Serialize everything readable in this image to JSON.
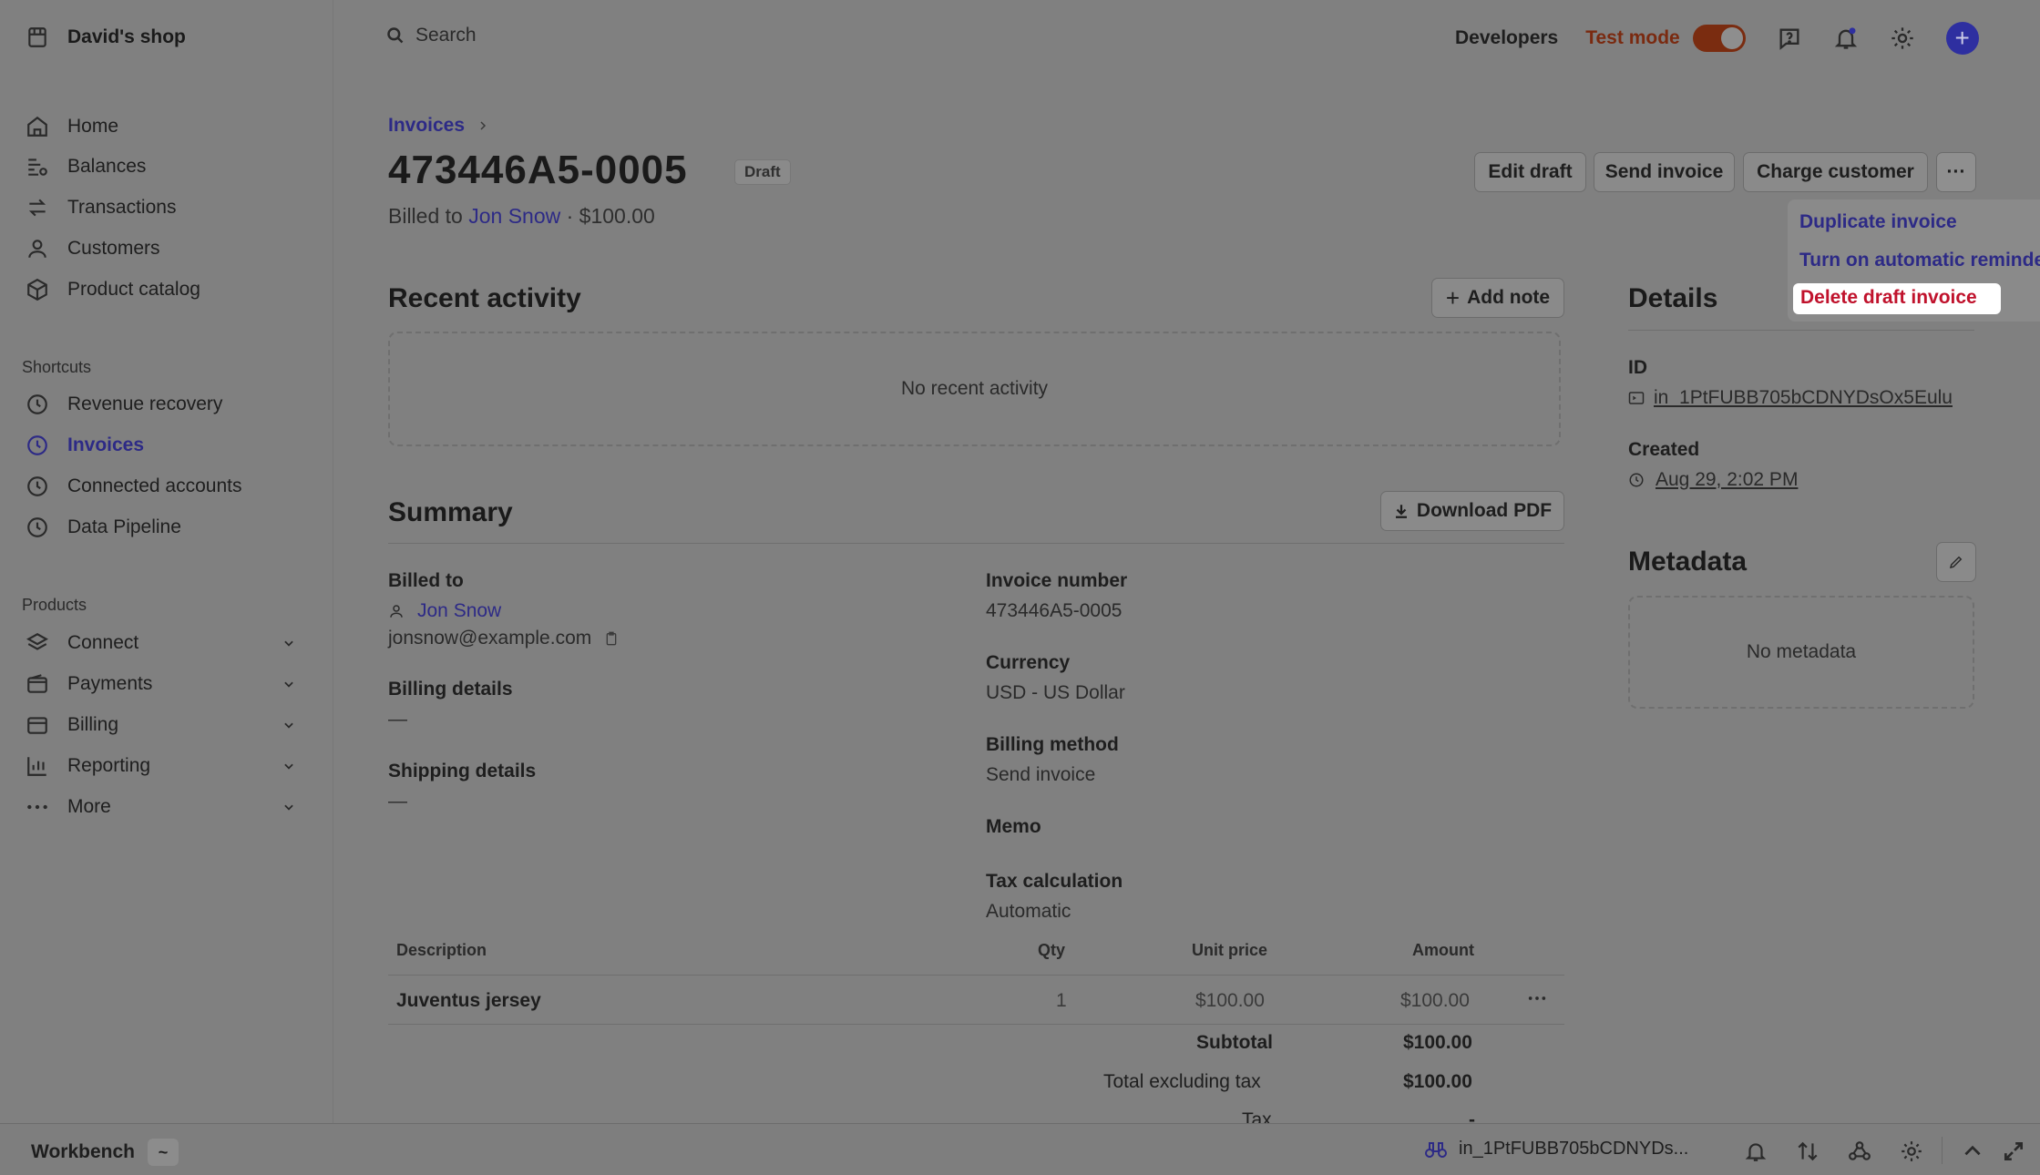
{
  "shop_name": "David's shop",
  "sidebar": {
    "main_items": [
      {
        "label": "Home",
        "icon": "home-icon"
      },
      {
        "label": "Balances",
        "icon": "balances-icon"
      },
      {
        "label": "Transactions",
        "icon": "transactions-icon"
      },
      {
        "label": "Customers",
        "icon": "customers-icon"
      },
      {
        "label": "Product catalog",
        "icon": "product-catalog-icon"
      }
    ],
    "shortcuts_heading": "Shortcuts",
    "shortcuts": [
      {
        "label": "Revenue recovery",
        "icon": "clock-icon"
      },
      {
        "label": "Invoices",
        "icon": "clock-icon",
        "active": true
      },
      {
        "label": "Connected accounts",
        "icon": "clock-icon"
      },
      {
        "label": "Data Pipeline",
        "icon": "clock-icon"
      }
    ],
    "products_heading": "Products",
    "products": [
      {
        "label": "Connect",
        "icon": "connect-icon"
      },
      {
        "label": "Payments",
        "icon": "payments-icon"
      },
      {
        "label": "Billing",
        "icon": "billing-icon"
      },
      {
        "label": "Reporting",
        "icon": "reporting-icon"
      },
      {
        "label": "More",
        "icon": "more-icon"
      }
    ]
  },
  "topbar": {
    "search_placeholder": "Search",
    "developers": "Developers",
    "test_mode": "Test mode",
    "test_mode_on": true
  },
  "page": {
    "breadcrumb": "Invoices",
    "title": "473446A5-0005",
    "status": "Draft",
    "billed_prefix": "Billed to",
    "customer": "Jon Snow",
    "billed_amount": "· $100.00",
    "actions": {
      "edit": "Edit draft",
      "send": "Send invoice",
      "charge": "Charge customer",
      "more": "···"
    },
    "menu": {
      "duplicate": "Duplicate invoice",
      "reminders": "Turn on automatic reminders",
      "delete": "Delete draft invoice"
    }
  },
  "activity": {
    "heading": "Recent activity",
    "add_note": "Add note",
    "empty": "No recent activity"
  },
  "summary": {
    "heading": "Summary",
    "download": "Download PDF",
    "billed_to_label": "Billed to",
    "customer": "Jon Snow",
    "email": "jonsnow@example.com",
    "billing_details_label": "Billing details",
    "billing_details": "—",
    "shipping_details_label": "Shipping details",
    "shipping_details": "—",
    "invoice_number_label": "Invoice number",
    "invoice_number": "473446A5-0005",
    "currency_label": "Currency",
    "currency": "USD - US Dollar",
    "billing_method_label": "Billing method",
    "billing_method": "Send invoice",
    "memo_label": "Memo",
    "tax_calc_label": "Tax calculation",
    "tax_calc": "Automatic"
  },
  "table": {
    "headers": {
      "description": "Description",
      "qty": "Qty",
      "unit_price": "Unit price",
      "amount": "Amount"
    },
    "row": {
      "description": "Juventus jersey",
      "qty": "1",
      "unit_price": "$100.00",
      "amount": "$100.00"
    },
    "subtotal_label": "Subtotal",
    "subtotal": "$100.00",
    "total_ex_tax_label": "Total excluding tax",
    "total_ex_tax": "$100.00",
    "tax_label": "Tax",
    "tax": "-"
  },
  "details": {
    "heading": "Details",
    "id_label": "ID",
    "id": "in_1PtFUBB705bCDNYDsOx5Eulu",
    "created_label": "Created",
    "created": "Aug 29, 2:02 PM"
  },
  "metadata": {
    "heading": "Metadata",
    "empty": "No metadata"
  },
  "bottom": {
    "workbench": "Workbench",
    "resource": "in_1PtFUBB705bCDNYDs..."
  }
}
